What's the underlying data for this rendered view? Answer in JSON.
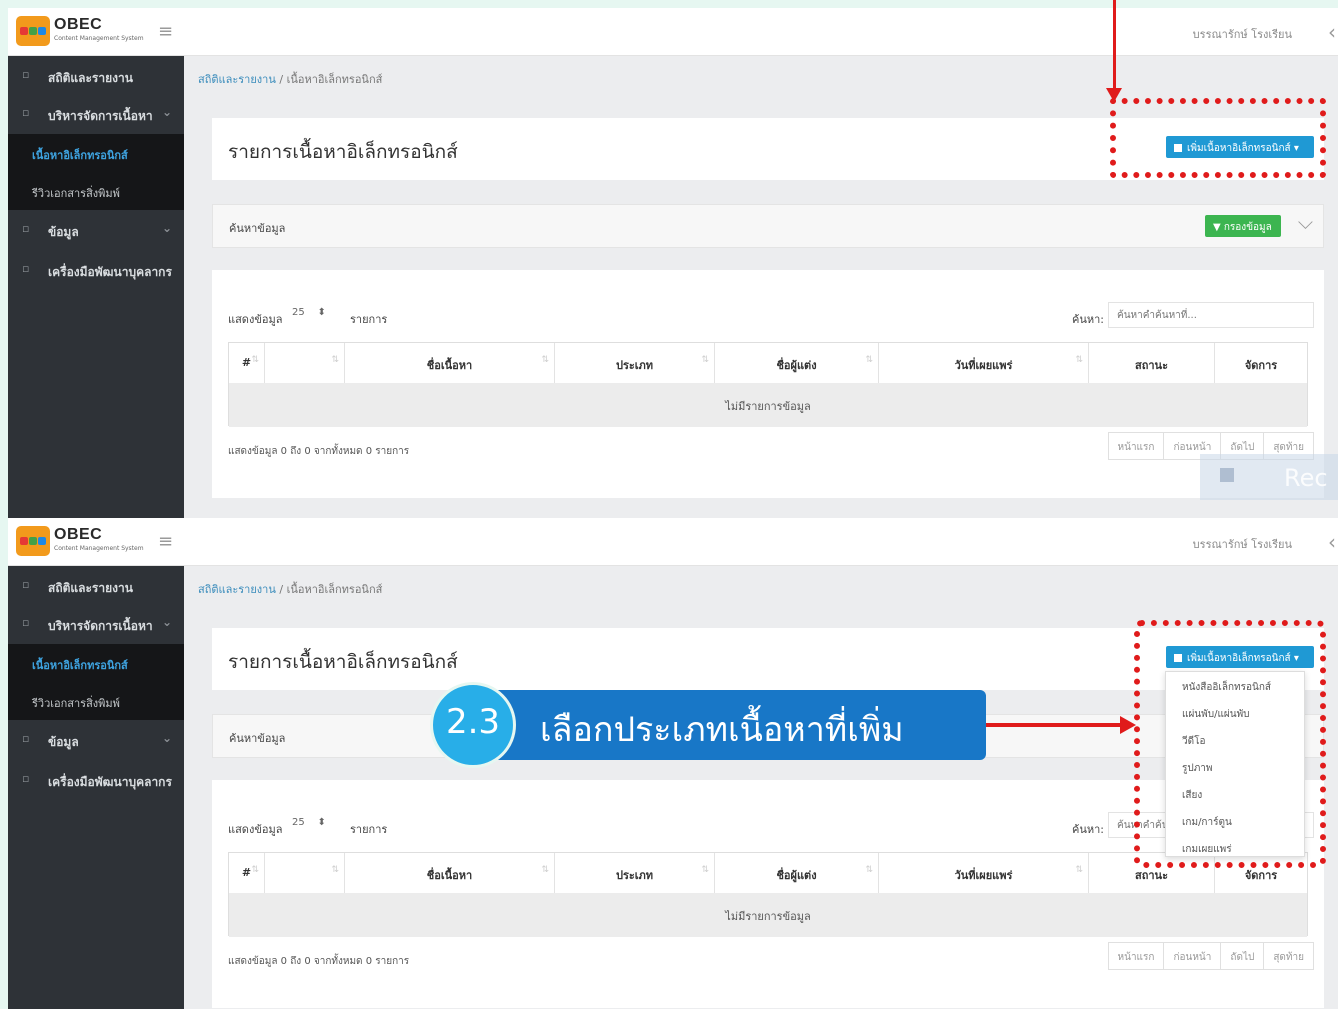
{
  "app": {
    "logo_title": "OBEC",
    "logo_sub": "Content Management System",
    "menu_icon": "hamburger-icon",
    "user_link": "บรรณารักษ์ โรงเรียน",
    "collapse_icon": "chevron-left-icon"
  },
  "sidebar": {
    "items": [
      {
        "label": "สถิติและรายงาน",
        "icon": "chart-icon"
      },
      {
        "label": "บริหารจัดการเนื้อหา",
        "icon": "edit-icon"
      },
      {
        "label": "ข้อมูล",
        "icon": "database-icon"
      },
      {
        "label": "เครื่องมือพัฒนาบุคลากร",
        "icon": "tools-icon"
      }
    ],
    "subitems": [
      {
        "label": "เนื้อหาอิเล็กทรอนิกส์"
      },
      {
        "label": "รีวิวเอกสารสิ่งพิมพ์"
      }
    ]
  },
  "breadcrumb": {
    "home": "สถิติและรายงาน",
    "separator": "/",
    "current": "เนื้อหาอิเล็กทรอนิกส์"
  },
  "page": {
    "title": "รายการเนื้อหาอิเล็กทรอนิกส์",
    "add_button": "เพิ่มเนื้อหาอิเล็กทรอนิกส์",
    "search_panel_title": "ค้นหาข้อมูล",
    "filter_button": "กรองข้อมูล"
  },
  "table": {
    "length_label": "แสดงข้อมูล",
    "length_value": "25",
    "length_suffix": "รายการ",
    "search_label": "ค้นหา:",
    "search_placeholder": "ค้นหาคำค้นหาที่...",
    "columns": [
      "#",
      "",
      "ชื่อเนื้อหา",
      "ประเภท",
      "ชื่อผู้แต่ง",
      "วันที่เผยแพร่",
      "สถานะ",
      "จัดการ"
    ],
    "empty_message": "ไม่มีรายการข้อมูล",
    "info": "แสดงข้อมูล 0 ถึง 0 จากทั้งหมด 0 รายการ",
    "pager": [
      "หน้าแรก",
      "ก่อนหน้า",
      "ถัดไป",
      "สุดท้าย"
    ]
  },
  "dropdown": {
    "items": [
      "หนังสืออิเล็กทรอนิกส์",
      "แผ่นพับ/แผ่นพับ",
      "วีดีโอ",
      "รูปภาพ",
      "เสียง",
      "เกม/การ์ตูน",
      "เกมเผยแพร่"
    ]
  },
  "callout": {
    "number": "2.3",
    "text": "เลือกประเภทเนื้อหาที่เพิ่ม"
  },
  "ghost": {
    "text": "Rec"
  },
  "colors": {
    "annotation_red": "#e01b1b",
    "callout_blue": "#1877c7",
    "callout_circle": "#28aee8",
    "button_blue": "#1f99d4",
    "button_green": "#3cb550",
    "sidebar_bg": "#2e3237"
  }
}
